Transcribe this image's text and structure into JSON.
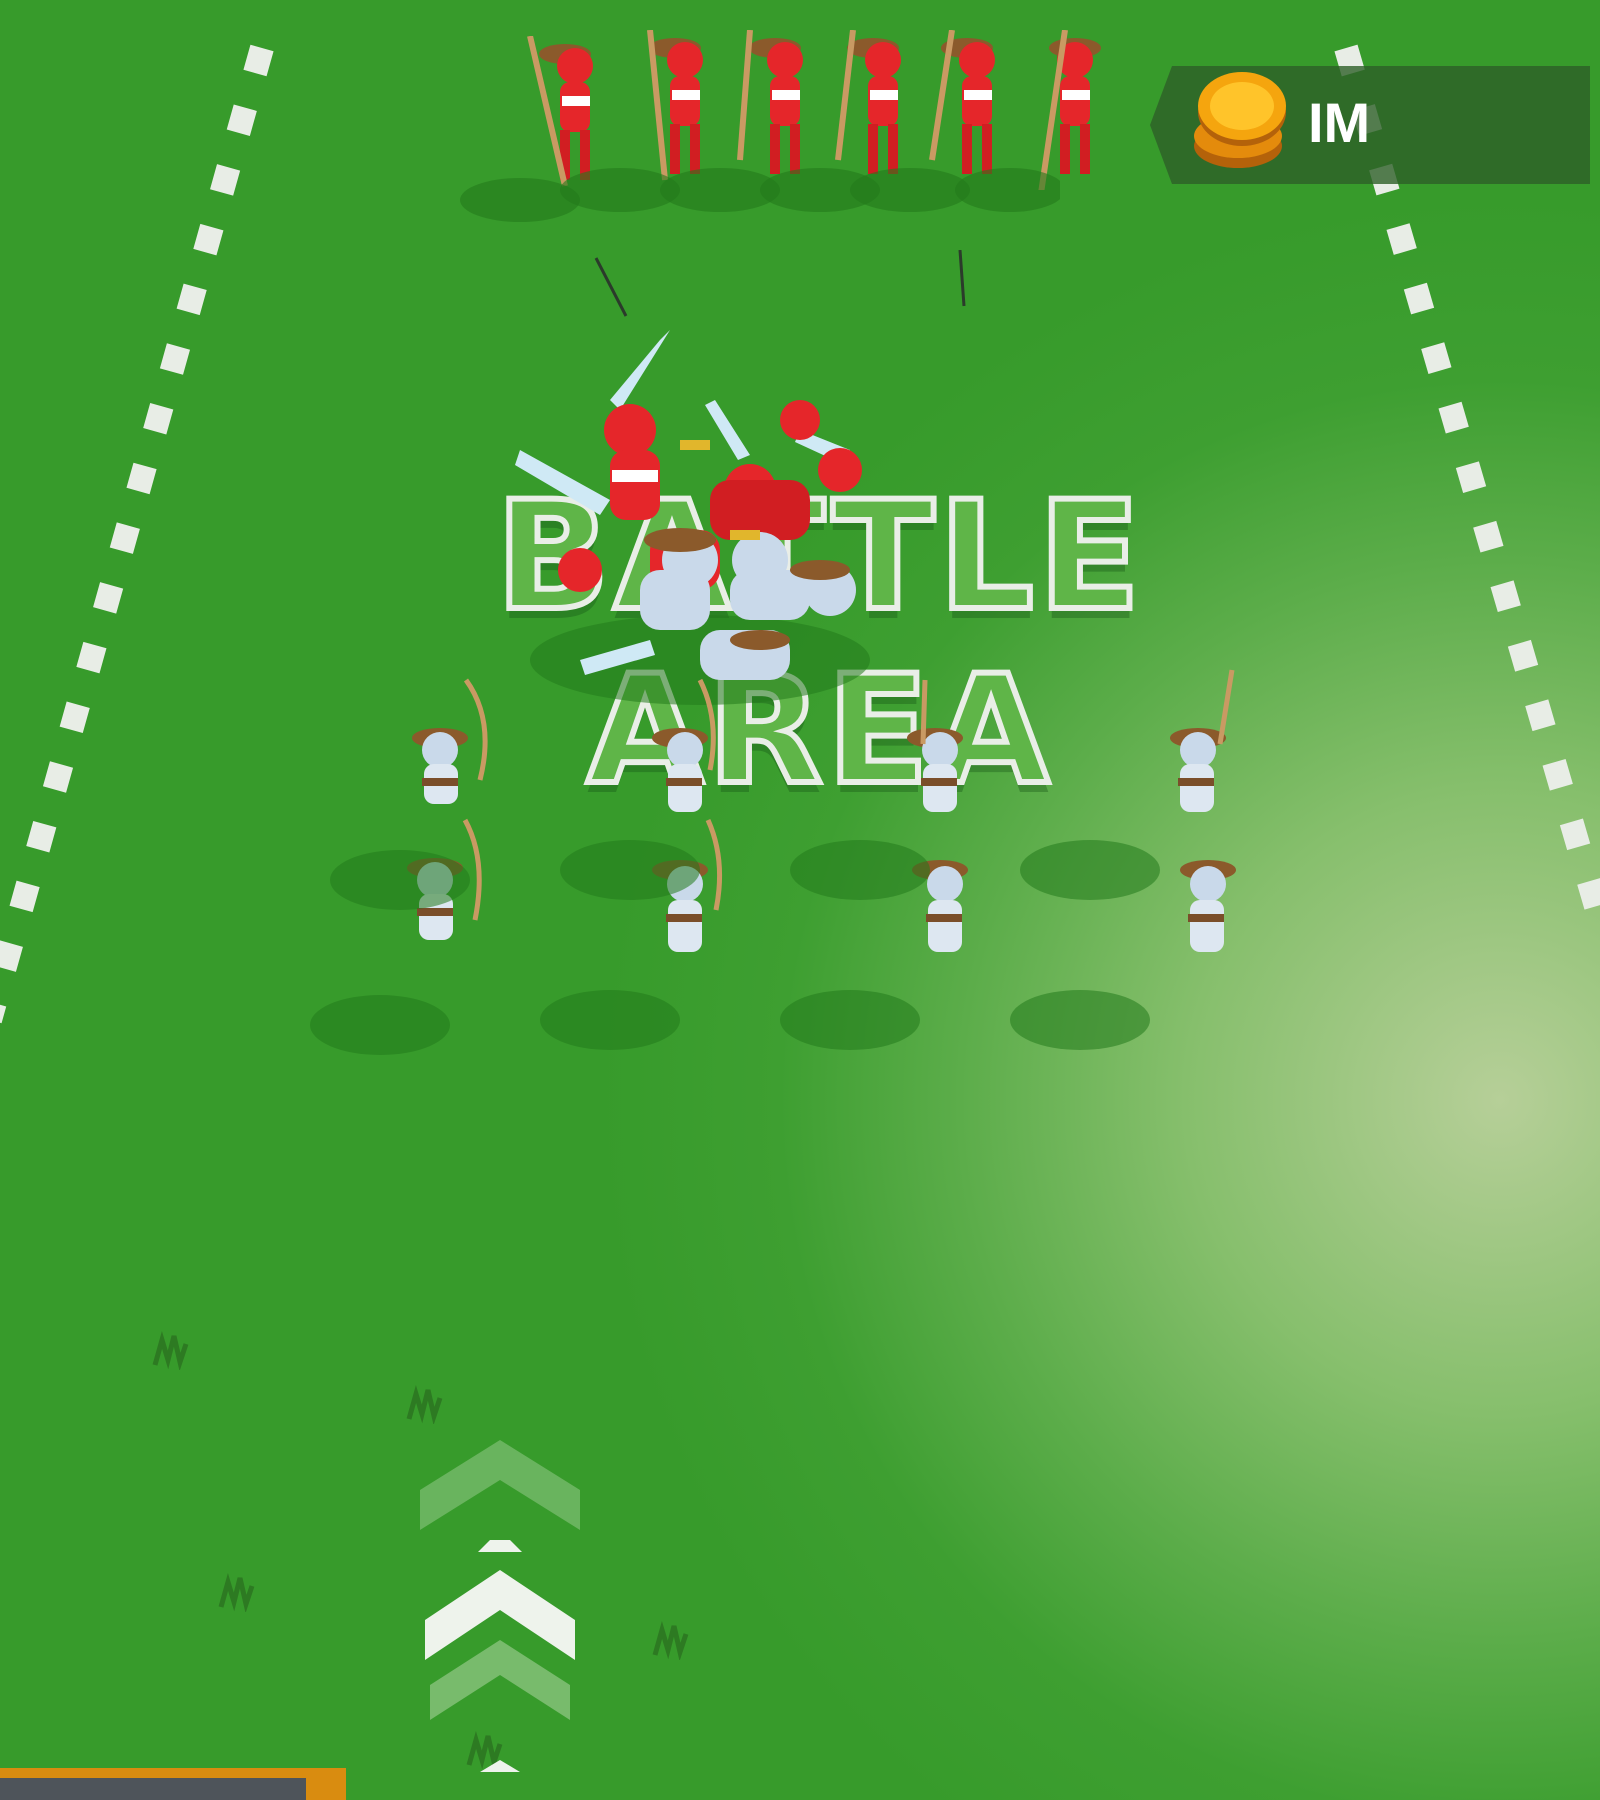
{
  "hud": {
    "coin_amount": "IM",
    "coin_icon": "gold-coin-stack-icon"
  },
  "field": {
    "center_label": "BATTLE AREA",
    "colors": {
      "grass": "#3e9f31",
      "red_team": "#e5262a",
      "blue_team": "#c9d9ea",
      "line": "#e8ede6",
      "coin": "#f5a50e"
    }
  },
  "teams": {
    "red_archers": 6,
    "white_archers": 10
  },
  "controls": {
    "advance_icon": "chevron-up-arrows-icon"
  }
}
